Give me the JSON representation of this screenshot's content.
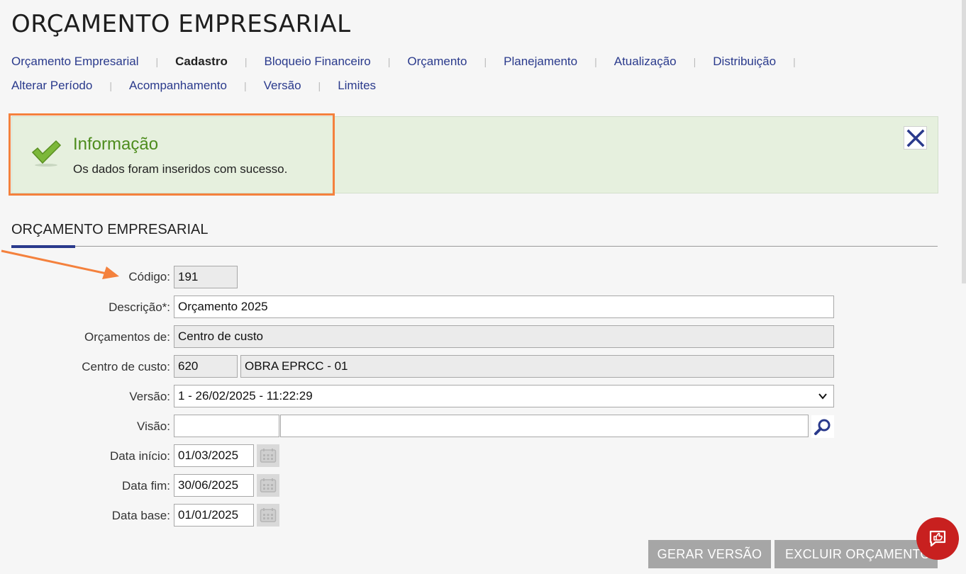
{
  "page": {
    "title": "ORÇAMENTO EMPRESARIAL"
  },
  "nav": {
    "row1": [
      "Orçamento Empresarial",
      "Cadastro",
      "Bloqueio Financeiro",
      "Orçamento",
      "Planejamento",
      "Atualização",
      "Distribuição"
    ],
    "row2": [
      "Alterar Período",
      "Acompanhamento",
      "Versão",
      "Limites"
    ],
    "active": "Cadastro"
  },
  "alert": {
    "title": "Informação",
    "message": "Os dados foram inseridos com sucesso.",
    "icon": "check-icon",
    "close_icon": "close-icon",
    "highlight_color": "#f4813d"
  },
  "section": {
    "title": "ORÇAMENTO EMPRESARIAL"
  },
  "form": {
    "codigo": {
      "label": "Código:",
      "value": "191"
    },
    "descricao": {
      "label": "Descrição*:",
      "value": "Orçamento 2025"
    },
    "orcamentos_de": {
      "label": "Orçamentos de:",
      "value": "Centro de custo"
    },
    "centro_custo": {
      "label": "Centro de custo:",
      "code": "620",
      "name": "OBRA EPRCC - 01"
    },
    "versao": {
      "label": "Versão:",
      "value": "1 - 26/02/2025 - 11:22:29"
    },
    "visao": {
      "label": "Visão:",
      "code": "",
      "name": ""
    },
    "data_inicio": {
      "label": "Data início:",
      "value": "01/03/2025"
    },
    "data_fim": {
      "label": "Data fim:",
      "value": "30/06/2025"
    },
    "data_base": {
      "label": "Data base:",
      "value": "01/01/2025"
    }
  },
  "buttons": {
    "gerar_versao": "GERAR VERSÃO",
    "excluir_orcamento": "EXCLUIR ORÇAMENTO"
  },
  "colors": {
    "nav_link": "#2a3a8c",
    "alert_bg": "#e6f0de",
    "alert_title": "#4d8c1d",
    "button_bg": "#a6a6a6",
    "chat_bg": "#c8201f"
  }
}
